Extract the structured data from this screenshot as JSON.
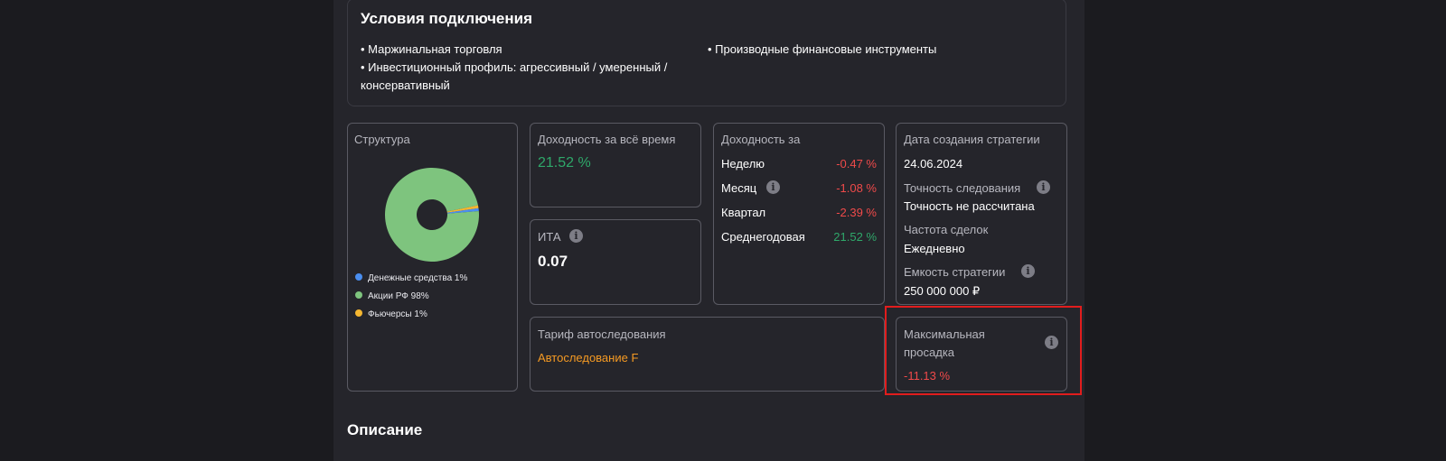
{
  "connection": {
    "title": "Условия подключения",
    "items": [
      "• Маржинальная торговля",
      "• Производные финансовые инструменты",
      "• Инвестиционный профиль: агрессивный / умеренный /",
      "консервативный"
    ]
  },
  "structure": {
    "label": "Структура",
    "legend": [
      {
        "label": "Денежные средства 1%",
        "color": "#4a8ef0"
      },
      {
        "label": "Акции РФ 98%",
        "color": "#7ec47e"
      },
      {
        "label": "Фьючерсы 1%",
        "color": "#f5b731"
      }
    ]
  },
  "chart_data": {
    "type": "pie",
    "categories": [
      "Денежные средства",
      "Акции РФ",
      "Фьючерсы"
    ],
    "values": [
      1,
      98,
      1
    ],
    "colors": [
      "#4a8ef0",
      "#7ec47e",
      "#f5b731"
    ]
  },
  "total_yield": {
    "label": "Доходность за всё время",
    "value": "21.52 %"
  },
  "ita": {
    "label": "ИТА",
    "value": "0.07"
  },
  "yield_period": {
    "label": "Доходность за",
    "rows": [
      {
        "label": "Неделю",
        "value": "-0.47 %"
      },
      {
        "label": "Месяц",
        "value": "-1.08 %"
      },
      {
        "label": "Квартал",
        "value": "-2.39 %"
      },
      {
        "label": "Среднегодовая",
        "value": "21.52 %"
      }
    ]
  },
  "strategy_info": {
    "created_label": "Дата создания стратегии",
    "created_value": "24.06.2024",
    "accuracy_label": "Точность следования",
    "accuracy_value": "Точность не рассчитана",
    "frequency_label": "Частота сделок",
    "frequency_value": "Ежедневно",
    "capacity_label": "Емкость стратегии",
    "capacity_value": "250 000 000 ₽"
  },
  "tariff": {
    "label": "Тариф автоследования",
    "value": "Автоследование F"
  },
  "drawdown": {
    "label_line1": "Максимальная",
    "label_line2": "просадка",
    "value": "-11.13 %"
  },
  "info_glyph": "i",
  "description_title": "Описание"
}
